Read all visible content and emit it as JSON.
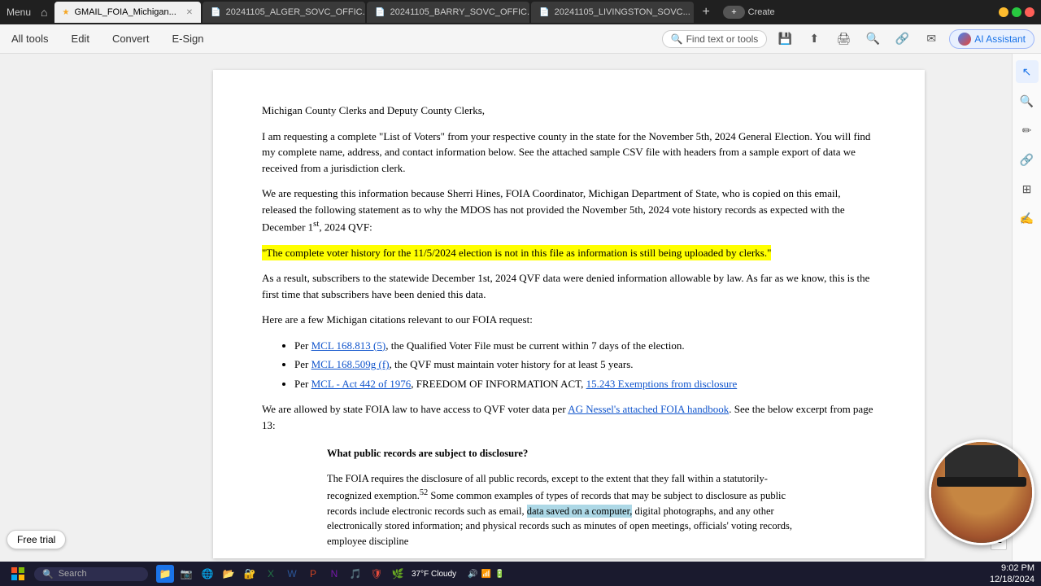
{
  "titlebar": {
    "menu_label": "Menu",
    "home_icon": "⌂",
    "tabs": [
      {
        "id": "tab1",
        "icon": "★",
        "label": "GMAIL_FOIA_Michigan...",
        "active": true
      },
      {
        "id": "tab2",
        "icon": "📄",
        "label": "20241105_ALGER_SOVC_OFFIC...",
        "active": false
      },
      {
        "id": "tab3",
        "icon": "📄",
        "label": "20241105_BARRY_SOVC_OFFIC...",
        "active": false
      },
      {
        "id": "tab4",
        "icon": "📄",
        "label": "20241105_LIVINGSTON_SOVC...",
        "active": false
      }
    ],
    "new_tab_label": "+",
    "create_label": "Create",
    "controls": {
      "minimize": "−",
      "maximize": "□",
      "close": "✕"
    }
  },
  "toolbar": {
    "all_tools": "All tools",
    "edit": "Edit",
    "convert": "Convert",
    "esign": "E-Sign",
    "find_placeholder": "Find text or tools",
    "ai_label": "AI Assistant",
    "icons": [
      "save",
      "upload",
      "print",
      "zoom-in",
      "link",
      "mail"
    ]
  },
  "sidebar_icons": {
    "cursor": "↖",
    "zoom": "🔍",
    "pencil": "✏",
    "link": "🔗",
    "table": "⊞",
    "signature": "✍",
    "more": "⋮"
  },
  "document": {
    "greeting": "Michigan County Clerks and Deputy County Clerks,",
    "para1": "I am requesting a complete \"List of Voters\" from your respective county in the state for the November 5th, 2024 General Election. You will find my complete name, address, and contact information below.  See the attached sample CSV file with headers from a sample export of data we received from a jurisdiction clerk.",
    "para2": "We are requesting this information because Sherri Hines, FOIA Coordinator, Michigan Department of State, who is copied on this email, released the following statement as to why the MDOS has not provided the November 5th, 2024 vote history records as expected with the December 1",
    "superscript_st": "st",
    "para2_end": ", 2024 QVF:",
    "highlighted_quote": "\"The complete voter history for the 11/5/2024 election is not in this file as information is still being uploaded by clerks.\"",
    "para3": "As a result, subscribers to the statewide December 1st, 2024 QVF data were denied information allowable by law.  As far as we know, this is the first time that subscribers have been denied this data.",
    "para4_intro": "Here are a few Michigan citations relevant to our FOIA request:",
    "bullets": [
      {
        "prefix": "Per ",
        "link": "MCL 168.813 (5)",
        "suffix": ", the Qualified Voter File must be current within 7 days of the election."
      },
      {
        "prefix": "Per ",
        "link": "MCL 168.509g (f)",
        "suffix": ", the QVF must maintain voter history for at least 5 years."
      },
      {
        "prefix": "Per ",
        "link": "MCL - Act 442 of 1976",
        "suffix": ", FREEDOM OF INFORMATION ACT, ",
        "link2": "15.243 Exemptions from disclosure",
        "suffix2": ""
      }
    ],
    "para5_prefix": "We are allowed by state FOIA law to have access to QVF voter data per ",
    "para5_link": "AG Nessel's attached FOIA handbook",
    "para5_suffix": ".  See the below excerpt from page 13:",
    "blockquote_title": "What public records are subject to disclosure?",
    "blockquote_para": "The FOIA requires the disclosure of all public records, except to the extent that they fall within a statutorily-recognized exemption.",
    "blockquote_superscript": "52",
    "blockquote_cont": " Some common examples of types of records that may be subject to disclosure as public records include electronic records such as email, ",
    "blockquote_highlight": "data saved on a computer,",
    "blockquote_end": " digital photographs, and any other electronically stored information; and physical records such as minutes of open meetings, officials' voting records, employee discipline"
  },
  "free_trial": {
    "label": "Free trial"
  },
  "page_number": {
    "value": "1"
  },
  "taskbar": {
    "start_icon": "⊞",
    "search_placeholder": "Search",
    "weather": "37°F\nCloudy",
    "time": "9:02 PM",
    "date": "12/18/2024",
    "apps": [
      "📁",
      "📷",
      "🌐",
      "📁",
      "🔐",
      "📊",
      "📝",
      "📊",
      "📝",
      "🎵",
      "🔒",
      "🌿"
    ],
    "tray_icons": [
      "🔊",
      "📶",
      "🔋"
    ]
  },
  "webcam": {
    "visible": true
  }
}
